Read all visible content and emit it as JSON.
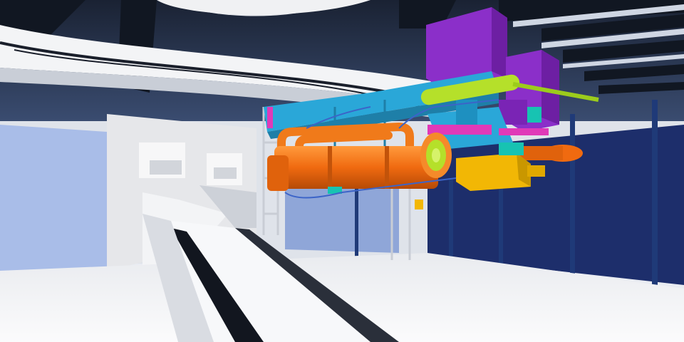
{
  "scene": {
    "colors": {
      "sky_dark": "#2c3e5e",
      "beam_dark": "#1b2230",
      "wall_blue": "#1d2e6b",
      "wall_light_blue": "#a9bde8",
      "floor": "#f2f3f5",
      "concrete": "#e6e7ea",
      "equipment_purple": "#8b2fc9",
      "equipment_cyan": "#2aa7d8",
      "equipment_orange": "#f06a10",
      "equipment_yellow": "#f2b705",
      "equipment_lime": "#b5e02a",
      "equipment_teal": "#17c3b2",
      "equipment_magenta": "#e03ab8"
    }
  }
}
